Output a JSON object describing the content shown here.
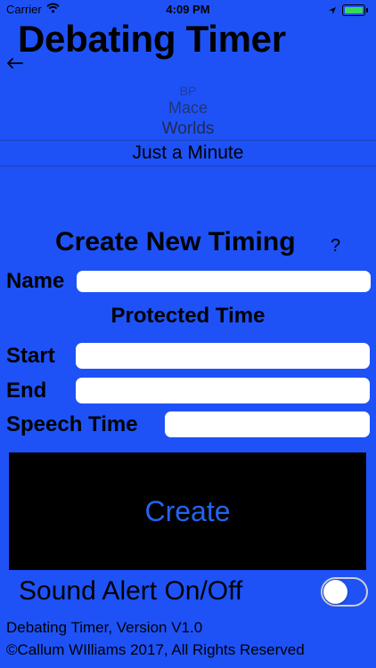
{
  "status_bar": {
    "carrier": "Carrier",
    "time": "4:09 PM",
    "battery_color": "#3BD75A"
  },
  "app": {
    "title": "Debating Timer",
    "back_icon": "arrow-left-icon"
  },
  "picker": {
    "items": [
      "BP",
      "Mace",
      "Worlds",
      "Just a Minute"
    ],
    "selected": "Just a Minute"
  },
  "form": {
    "heading": "Create New Timing",
    "help": "?",
    "name_label": "Name",
    "name_value": "",
    "protected_heading": "Protected Time",
    "start_label": "Start",
    "start_value": "",
    "end_label": "End",
    "end_value": "",
    "speech_label": "Speech Time",
    "speech_value": "",
    "create_label": "Create"
  },
  "sound": {
    "label": "Sound Alert On/Off",
    "enabled": false
  },
  "footer": {
    "version": "Debating Timer, Version V1.0",
    "copyright": "©Callum WIlliams 2017, All Rights Reserved"
  },
  "colors": {
    "background": "#1E52F7",
    "create_button_bg": "#000000",
    "create_button_text": "#2463F0"
  }
}
